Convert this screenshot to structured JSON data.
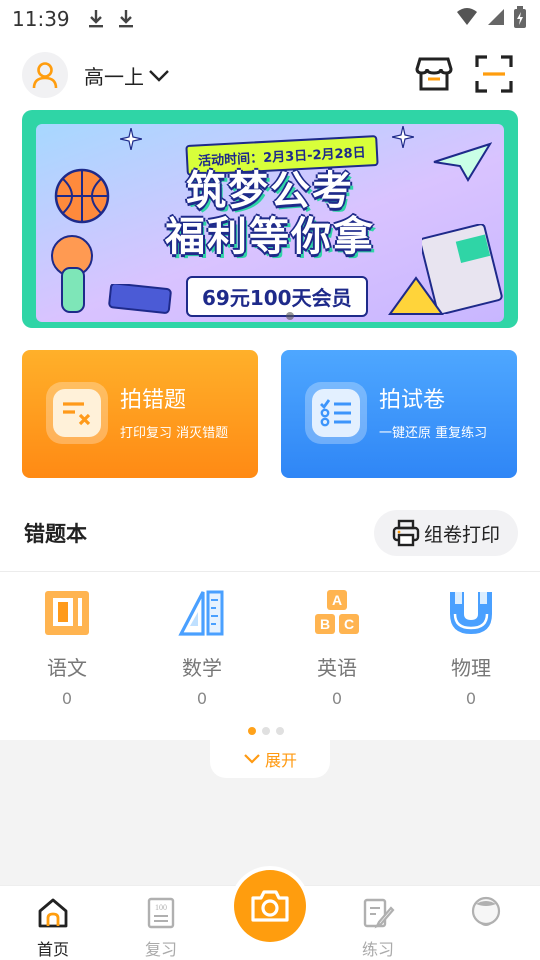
{
  "status": {
    "time": "11:39"
  },
  "header": {
    "grade": "高一上"
  },
  "banner": {
    "date_text": "活动时间：2月3日-2月28日",
    "title_line1": "筑梦公考",
    "title_line2": "福利等你拿",
    "offer": "69元100天会员"
  },
  "cards": [
    {
      "title": "拍错题",
      "subtitle": "打印复习 消灭错题",
      "color": "#ff9a1a"
    },
    {
      "title": "拍试卷",
      "subtitle": "一键还原 重复练习",
      "color": "#3d95fb"
    }
  ],
  "section": {
    "title": "错题本",
    "print_label": "组卷打印"
  },
  "subjects": [
    {
      "name": "语文",
      "count": "0",
      "icon": "book-icon"
    },
    {
      "name": "数学",
      "count": "0",
      "icon": "ruler-icon"
    },
    {
      "name": "英语",
      "count": "0",
      "icon": "abc-blocks-icon"
    },
    {
      "name": "物理",
      "count": "0",
      "icon": "magnet-icon"
    }
  ],
  "expand_label": "展开",
  "tabs": [
    {
      "label": "首页",
      "icon": "home-icon",
      "active": true
    },
    {
      "label": "复习",
      "icon": "review-icon",
      "active": false
    },
    {
      "label": "练习",
      "icon": "practice-icon",
      "active": false
    },
    {
      "label": "",
      "icon": "profile-icon",
      "active": false
    }
  ],
  "colors": {
    "accent": "#ff9d0e",
    "blue": "#3d95fb"
  }
}
